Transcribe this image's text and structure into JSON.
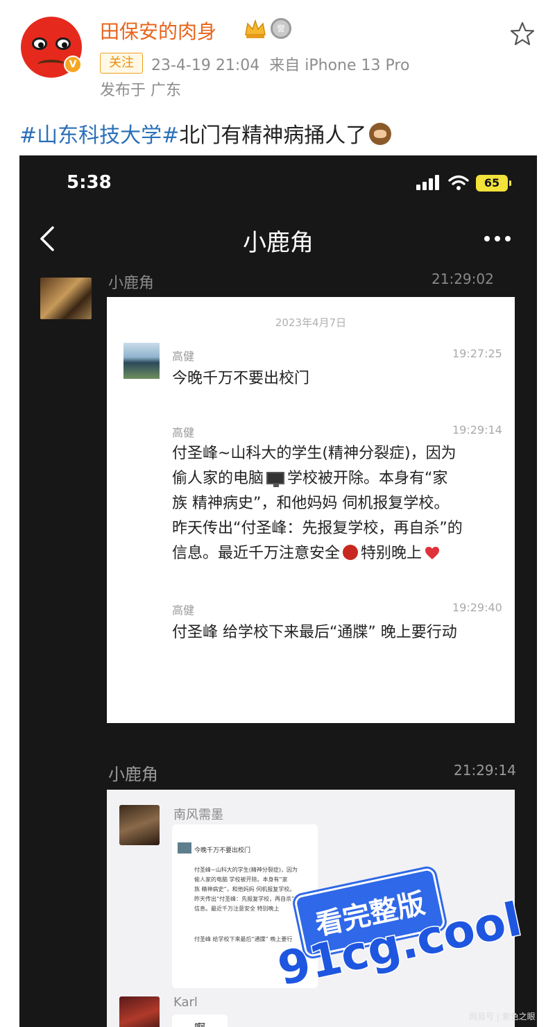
{
  "post": {
    "username": "田保安的肉身",
    "follow_label": "关注",
    "timestamp": "23-4-19 21:04",
    "device": "来自 iPhone 13 Pro",
    "location": "发布于 广东",
    "hashtag": "#山东科技大学#",
    "text": "北门有精神病捅人了",
    "colors": {
      "username": "#e8641b",
      "hashtag": "#2b6fb8"
    }
  },
  "phone": {
    "status_time": "5:38",
    "battery": "65",
    "chat_title": "小鹿角",
    "top_message": {
      "sender": "小鹿角",
      "time": "21:29:02"
    },
    "card1": {
      "date": "2023年4月7日",
      "messages": [
        {
          "sender": "高健",
          "time": "19:27:25",
          "lines": [
            "今晚千万不要出校门"
          ]
        },
        {
          "sender": "高健",
          "time": "19:29:14",
          "lines": [
            "付圣峰~山科大的学生(精神分裂症)，因为",
            "偷人家的电脑",
            "学校被开除。本身有“家",
            "族 精神病史”，和他妈妈 伺机报复学校。",
            "昨天传出“付圣峰：先报复学校，再自杀”的",
            "信息。最近千万注意安全",
            "特别晚上"
          ]
        },
        {
          "sender": "高健",
          "time": "19:29:40",
          "lines": [
            "付圣峰 给学校下来最后“通牒” 晚上要行动"
          ]
        }
      ]
    },
    "second_message": {
      "sender": "小鹿角",
      "time": "21:29:14"
    },
    "card2": {
      "sender1": "南风需墨",
      "mini_title": "今晚千万不要出校门",
      "mini_lines": [
        "付圣峰~山科大的学生(精神分裂症)，因为",
        "偷人家的电脑 学校被开除。本身有“家",
        "族 精神病史”，和他妈妈 伺机报复学校。",
        "昨天传出“付圣峰：先报复学校，再自杀”的",
        "信息。最近千万注意安全 特别晚上"
      ],
      "mini_last": "付圣峰 给学校下来最后“通牒” 晚上要行",
      "sender2": "Karl",
      "reply": "啊"
    }
  },
  "overlay": {
    "ad_badge": "看完整版",
    "ad_domain": "91cg.cool",
    "source": "网易号 | 紫色之眼"
  }
}
